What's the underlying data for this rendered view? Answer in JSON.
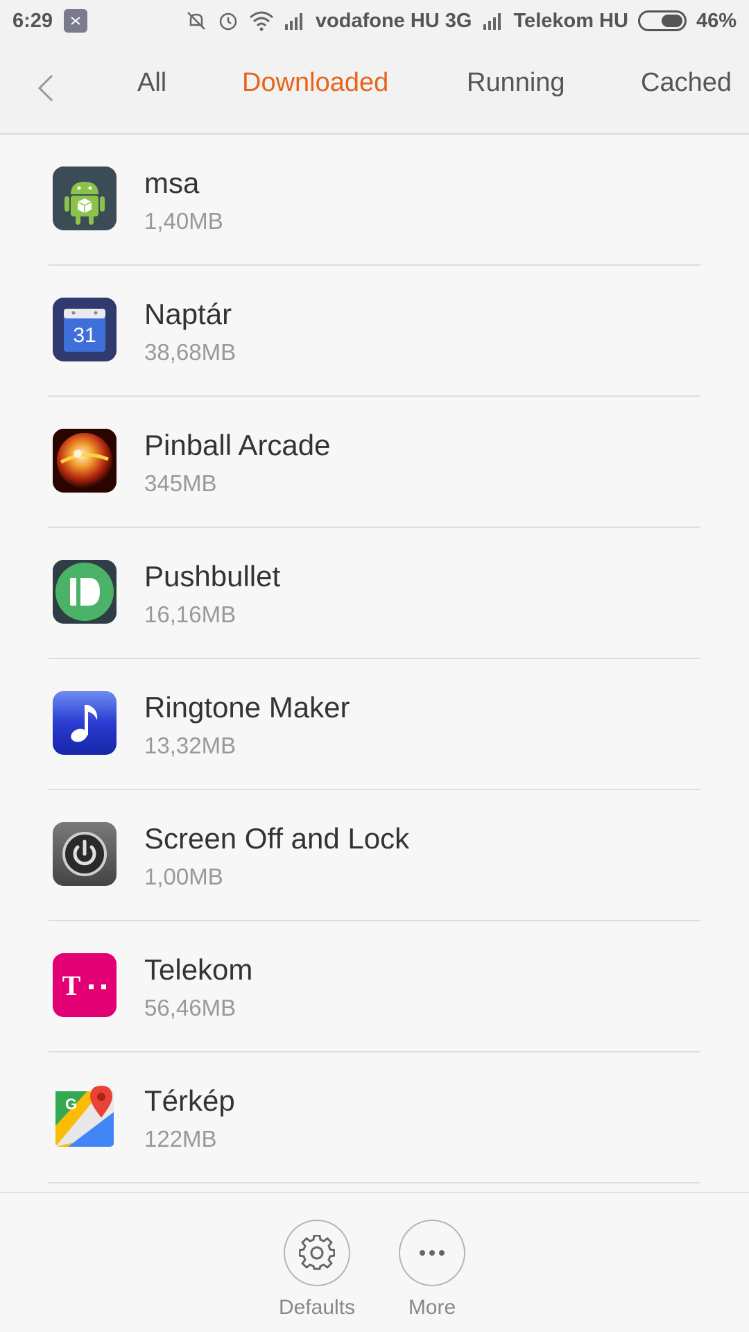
{
  "status_bar": {
    "time": "6:29",
    "carrier1": "vodafone HU 3G",
    "carrier2": "Telekom HU",
    "battery": "46%",
    "battery_level": 0.46
  },
  "tabs": {
    "all": "All",
    "downloaded": "Downloaded",
    "running": "Running",
    "cached": "Cached",
    "active": "Downloaded"
  },
  "apps": [
    {
      "name": "msa",
      "size": "1,40MB",
      "icon": "android-box-icon"
    },
    {
      "name": "Naptár",
      "size": "38,68MB",
      "icon": "calendar-icon"
    },
    {
      "name": "Pinball Arcade",
      "size": "345MB",
      "icon": "pinball-icon"
    },
    {
      "name": "Pushbullet",
      "size": "16,16MB",
      "icon": "pushbullet-icon"
    },
    {
      "name": "Ringtone Maker",
      "size": "13,32MB",
      "icon": "music-note-icon"
    },
    {
      "name": "Screen Off and Lock",
      "size": "1,00MB",
      "icon": "power-icon"
    },
    {
      "name": "Telekom",
      "size": "56,46MB",
      "icon": "telekom-icon"
    },
    {
      "name": "Térkép",
      "size": "122MB",
      "icon": "maps-icon"
    }
  ],
  "calendar_day": "31",
  "telekom_letter": "T",
  "maps_letter": "G",
  "actions": {
    "defaults": "Defaults",
    "more": "More"
  },
  "colors": {
    "accent": "#e8641b",
    "telekom": "#e20074"
  }
}
